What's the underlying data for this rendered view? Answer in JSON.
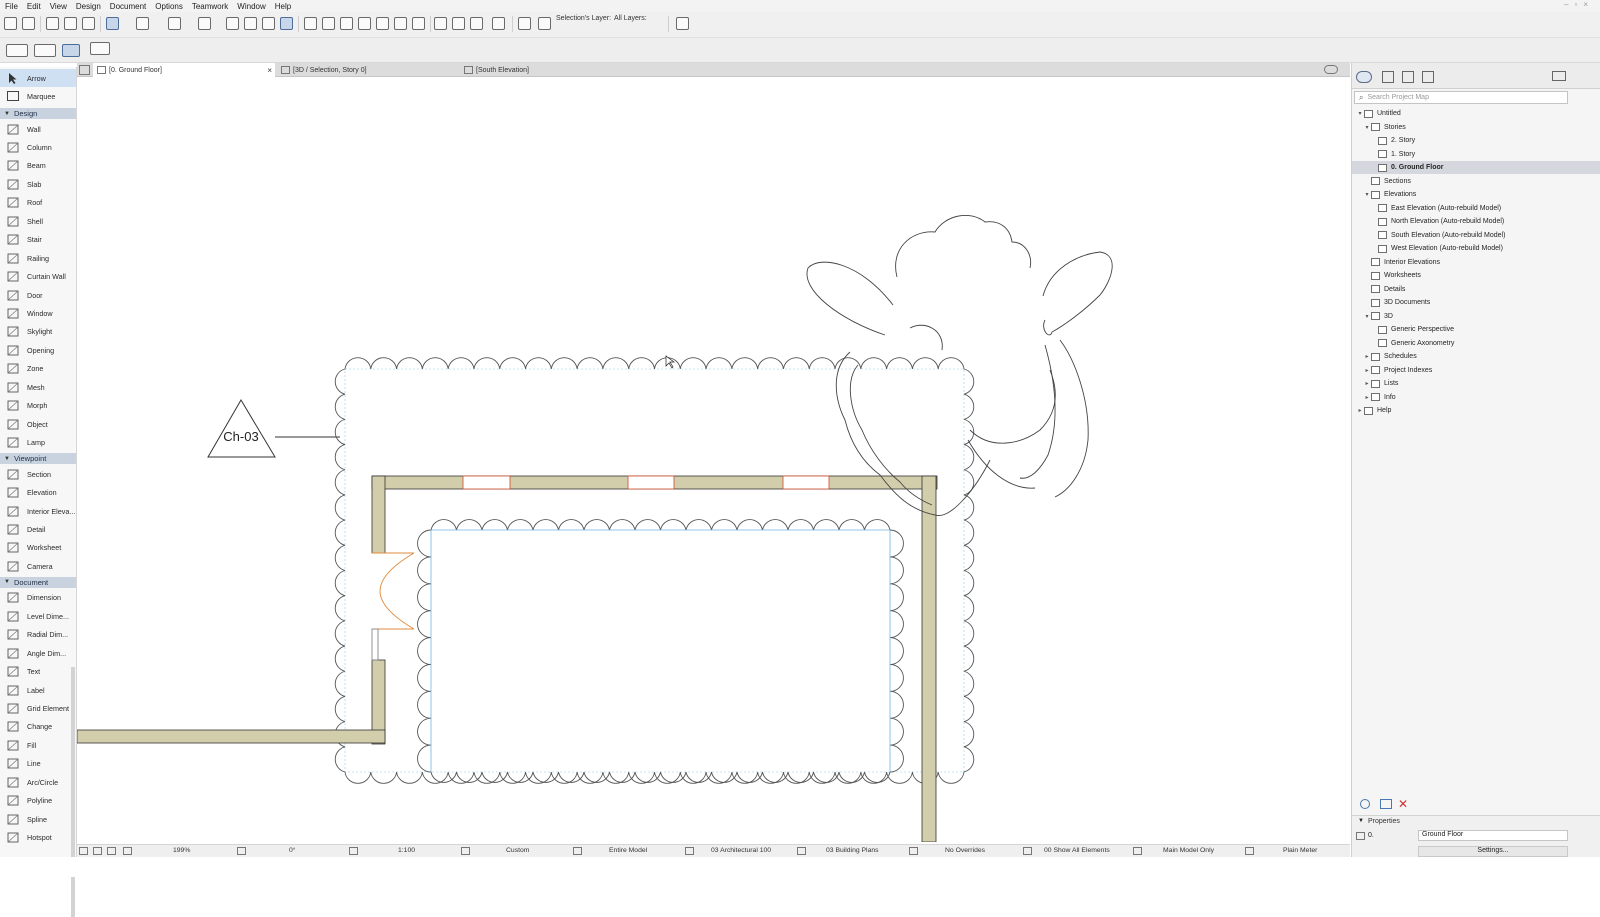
{
  "menu": [
    "File",
    "Edit",
    "View",
    "Design",
    "Document",
    "Options",
    "Teamwork",
    "Window",
    "Help"
  ],
  "toolbar": {
    "selection_layer_label": "Selection's Layer:",
    "all_layers_label": "All Layers:"
  },
  "toolbox": {
    "top_tools": [
      {
        "label": "Arrow",
        "icon": "arrow-icon"
      },
      {
        "label": "Marquee",
        "icon": "marquee-icon"
      }
    ],
    "groups": [
      {
        "name": "Design",
        "tools": [
          "Wall",
          "Column",
          "Beam",
          "Slab",
          "Roof",
          "Shell",
          "Stair",
          "Railing",
          "Curtain Wall",
          "Door",
          "Window",
          "Skylight",
          "Opening",
          "Zone",
          "Mesh",
          "Morph",
          "Object",
          "Lamp"
        ]
      },
      {
        "name": "Viewpoint",
        "tools": [
          "Section",
          "Elevation",
          "Interior Eleva...",
          "Detail",
          "Worksheet",
          "Camera"
        ]
      },
      {
        "name": "Document",
        "tools": [
          "Dimension",
          "Level Dime...",
          "Radial Dim...",
          "Angle Dim...",
          "Text",
          "Label",
          "Grid Element",
          "Change",
          "Fill",
          "Line",
          "Arc/Circle",
          "Polyline",
          "Spline",
          "Hotspot"
        ]
      }
    ]
  },
  "tabs": [
    "[0. Ground Floor]",
    "[3D / Selection, Story 0]",
    "[South Elevation]"
  ],
  "drawing": {
    "marker_label": "Ch-03"
  },
  "navigator": {
    "search_placeholder": "Search Project Map",
    "tree": [
      {
        "label": "Untitled",
        "level": 0,
        "expanded": true
      },
      {
        "label": "Stories",
        "level": 1,
        "expanded": true
      },
      {
        "label": "2. Story",
        "level": 2
      },
      {
        "label": "1. Story",
        "level": 2
      },
      {
        "label": "0. Ground Floor",
        "level": 2,
        "selected": true
      },
      {
        "label": "Sections",
        "level": 1
      },
      {
        "label": "Elevations",
        "level": 1,
        "expanded": true
      },
      {
        "label": "East Elevation (Auto-rebuild Model)",
        "level": 2
      },
      {
        "label": "North Elevation (Auto-rebuild Model)",
        "level": 2
      },
      {
        "label": "South Elevation (Auto-rebuild Model)",
        "level": 2
      },
      {
        "label": "West Elevation (Auto-rebuild Model)",
        "level": 2
      },
      {
        "label": "Interior Elevations",
        "level": 1
      },
      {
        "label": "Worksheets",
        "level": 1
      },
      {
        "label": "Details",
        "level": 1
      },
      {
        "label": "3D Documents",
        "level": 1
      },
      {
        "label": "3D",
        "level": 1,
        "expanded": true
      },
      {
        "label": "Generic Perspective",
        "level": 2
      },
      {
        "label": "Generic Axonometry",
        "level": 2
      },
      {
        "label": "Schedules",
        "level": 1,
        "collapsed": true
      },
      {
        "label": "Project Indexes",
        "level": 1,
        "collapsed": true
      },
      {
        "label": "Lists",
        "level": 1,
        "collapsed": true
      },
      {
        "label": "Info",
        "level": 1,
        "collapsed": true
      },
      {
        "label": "Help",
        "level": 0,
        "collapsed": true
      }
    ],
    "properties_label": "Properties",
    "story_number": "0.",
    "story_name": "Ground Floor",
    "settings_label": "Settings..."
  },
  "statusbar": {
    "zoom": "199%",
    "angle": "0°",
    "scale": "1:100",
    "structure": "Custom",
    "model_filter": "Entire Model",
    "pen_set": "03 Architectural 100",
    "model_view": "03 Building Plans",
    "overrides": "No Overrides",
    "renovation": "00 Show All Elements",
    "model_only": "Main Model Only",
    "dimension": "Plain Meter"
  },
  "colors": {
    "wall_fill": "#d2ceac",
    "wall_stroke": "#333333",
    "door_color": "#e08a3c",
    "window_color": "#d04a2a",
    "revision_cloud": "#6db8e3",
    "selection": "#cfe0f3",
    "group_header": "#c9d3e0"
  }
}
